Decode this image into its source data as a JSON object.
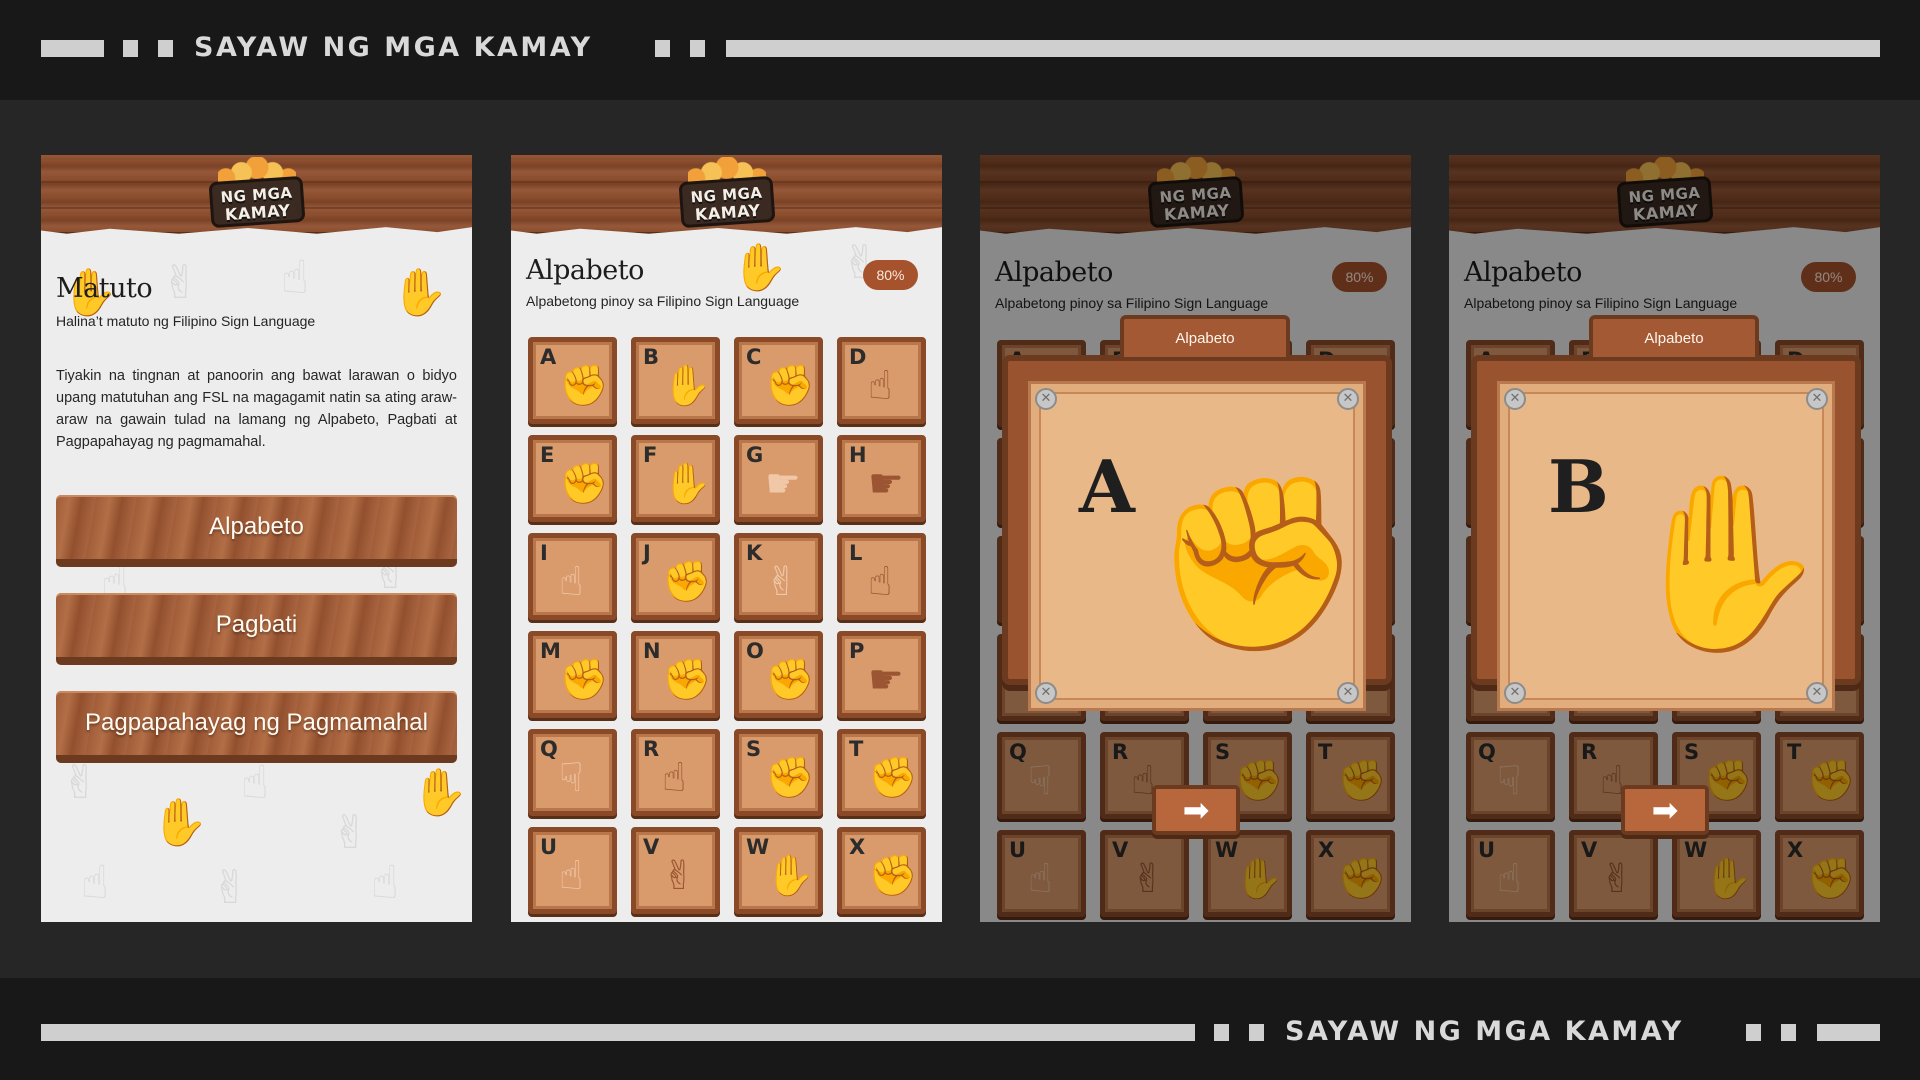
{
  "banner": {
    "title": "SAYAW NG MGA KAMAY"
  },
  "logo": {
    "line1": "NG MGA",
    "line2": "KAMAY"
  },
  "screen1": {
    "title": "Matuto",
    "subtitle": "Halina’t matuto ng Filipino Sign Language",
    "body": "Tiyakin na tingnan at panoorin ang bawat larawan o bidyo upang matutuhan ang FSL na magagamit natin sa ating araw-araw na gawain tulad na lamang ng Alpabeto, Pagbati at Pagpapahayag ng pagmamahal.",
    "buttons": [
      "Alpabeto",
      "Pagbati",
      "Pagpapahayag ng Pagmamahal"
    ]
  },
  "alphabet": {
    "title": "Alpabeto",
    "subtitle": "Alpabetong pinoy sa Filipino Sign Language",
    "progress": "80%",
    "progress_value": 0.8,
    "letters": [
      "A",
      "B",
      "C",
      "D",
      "E",
      "F",
      "G",
      "H",
      "I",
      "J",
      "K",
      "L",
      "M",
      "N",
      "O",
      "P",
      "Q",
      "R",
      "S",
      "T",
      "U",
      "V",
      "W",
      "X"
    ]
  },
  "modal_a": {
    "tab": "Alpabeto",
    "letter": "A",
    "next_icon": "arrow-right-icon"
  },
  "modal_b": {
    "tab": "Alpabeto",
    "letter": "B",
    "next_icon": "arrow-right-icon"
  },
  "colors": {
    "wood": "#9a532f",
    "wood_dark": "#6b3a1f",
    "tile": "#d99a6c",
    "badge": "#a6522c",
    "card": "#e8b888"
  }
}
